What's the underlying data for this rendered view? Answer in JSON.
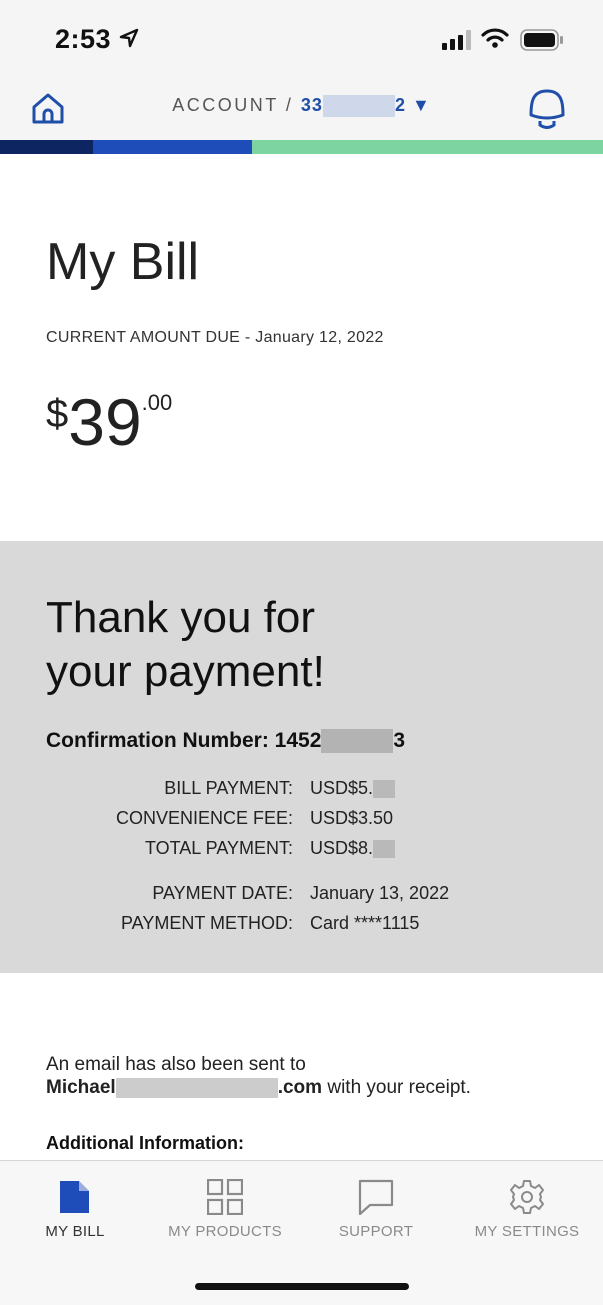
{
  "status_bar": {
    "time": "2:53"
  },
  "header": {
    "account_label": "ACCOUNT /",
    "account_prefix": "33",
    "account_suffix": "2",
    "dropdown_glyph": "▼"
  },
  "bill": {
    "title": "My Bill",
    "due_label": "CURRENT AMOUNT DUE - January 12, 2022",
    "currency": "$",
    "amount_whole": "39",
    "amount_cents": ".00"
  },
  "payment": {
    "thanks_line1": "Thank you for",
    "thanks_line2": "your payment!",
    "confirmation_label": "Confirmation Number:",
    "confirmation_prefix": "1452",
    "confirmation_suffix": "3",
    "rows": [
      {
        "label": "BILL PAYMENT:",
        "value": "USD$5."
      },
      {
        "label": "CONVENIENCE FEE:",
        "value": "USD$3.50"
      },
      {
        "label": "TOTAL PAYMENT:",
        "value": "USD$8."
      },
      {
        "label": "PAYMENT DATE:",
        "value": "January 13, 2022"
      },
      {
        "label": "PAYMENT METHOD:",
        "value": "Card ****1115"
      }
    ]
  },
  "email": {
    "line1": "An email has also been sent to",
    "address_prefix": "Michael",
    "address_suffix": ".com",
    "line2_tail": " with your receipt."
  },
  "additional_info_label": "Additional Information:",
  "tabs": [
    {
      "label": "MY BILL",
      "icon": "document-icon",
      "active": true
    },
    {
      "label": "MY PRODUCTS",
      "icon": "grid-icon",
      "active": false
    },
    {
      "label": "SUPPORT",
      "icon": "chat-bubble-icon",
      "active": false
    },
    {
      "label": "MY SETTINGS",
      "icon": "gear-icon",
      "active": false
    }
  ],
  "colors": {
    "accent_blue": "#1e4cb8",
    "navy": "#0d2560",
    "green": "#7ed4a0",
    "panel_gray": "#d9d9d9"
  }
}
